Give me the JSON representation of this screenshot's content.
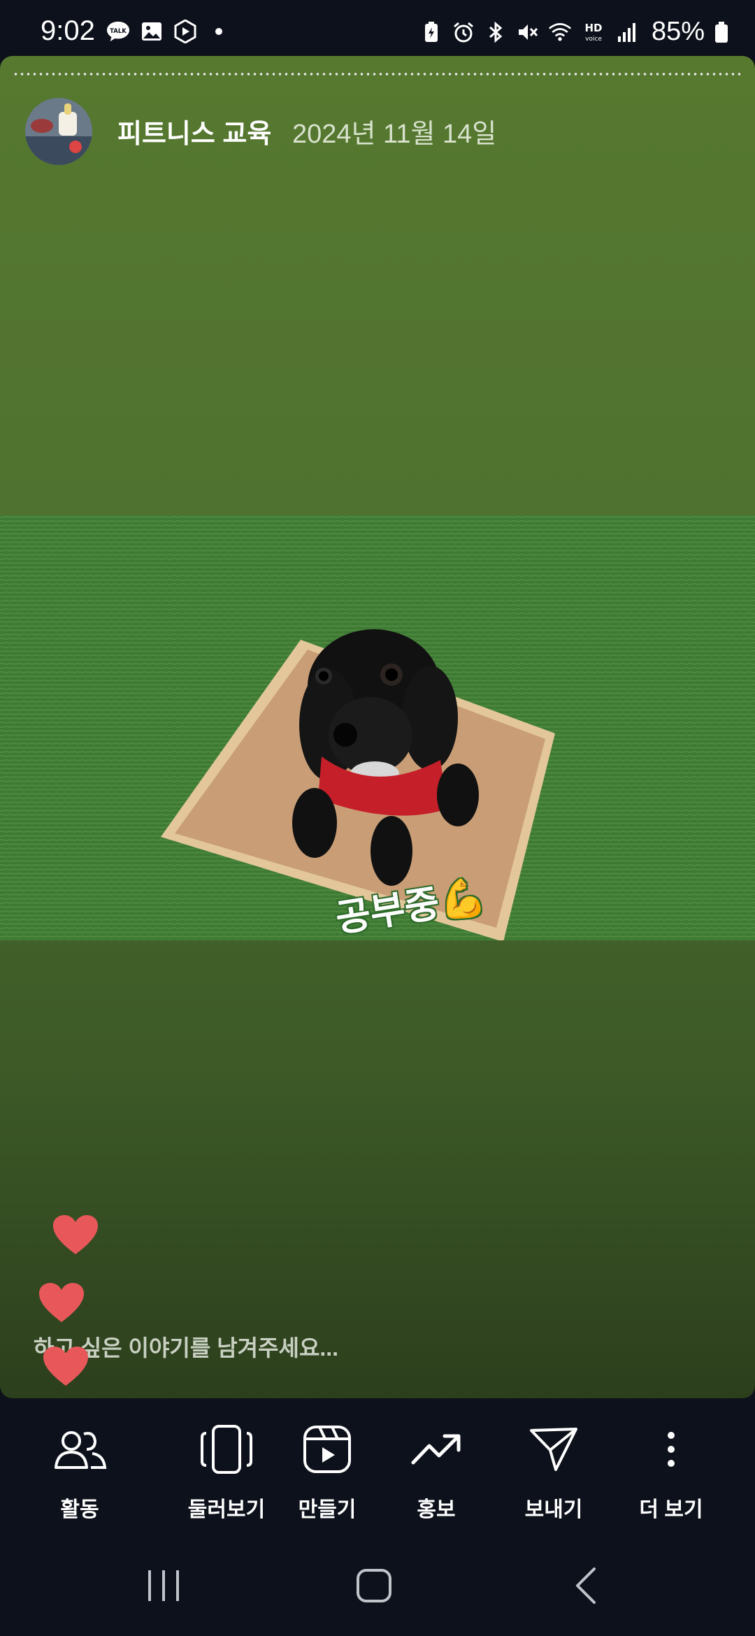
{
  "status_bar": {
    "time": "9:02",
    "battery": "85%",
    "left_icons": [
      "talk-icon",
      "gallery-icon",
      "play-shield-icon",
      "dot-icon"
    ],
    "right_icons": [
      "battery-saver-icon",
      "alarm-icon",
      "bluetooth-icon",
      "mute-icon",
      "wifi-icon",
      "hd-voice-icon",
      "signal-icon",
      "battery-icon"
    ]
  },
  "story": {
    "username": "피트니스 교육",
    "date": "2024년 11월 14일",
    "caption": "공부중💪",
    "reply_placeholder": "하고 싶은 이야기를 남겨주세요..."
  },
  "bottom_nav": {
    "activity": "활동",
    "browse": "둘러보기",
    "create": "만들기",
    "promote": "홍보",
    "send": "보내기",
    "more": "더 보기"
  },
  "colors": {
    "accent_heart": "#e8585a",
    "story_green": "#4f7230",
    "background": "#0d111b"
  }
}
